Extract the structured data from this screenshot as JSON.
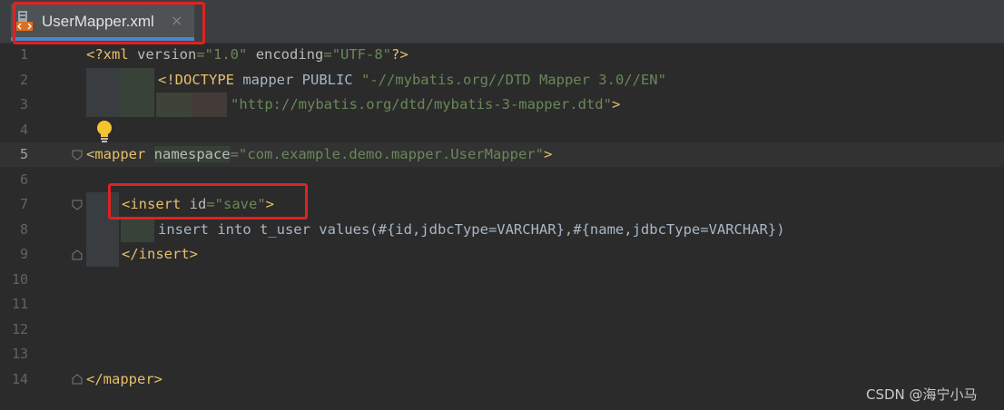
{
  "tab": {
    "title": "UserMapper.xml",
    "close_glyph": "×",
    "icon": "xml-file-icon"
  },
  "editor": {
    "current_line": 5,
    "line_numbers": [
      "1",
      "2",
      "3",
      "4",
      "5",
      "6",
      "7",
      "8",
      "9",
      "10",
      "11",
      "12",
      "13",
      "14"
    ],
    "lines": {
      "l1": {
        "a": "<?xml ",
        "b": "version",
        "c": "=",
        "d": "\"1.0\"",
        "e": " ",
        "f": "encoding",
        "g": "=",
        "h": "\"UTF-8\"",
        "i": "?>"
      },
      "l2": {
        "a": "<!DOCTYPE ",
        "b": "mapper PUBLIC ",
        "c": "\"-//mybatis.org//DTD Mapper 3.0//EN\""
      },
      "l3": {
        "a": "\"http://mybatis.org/dtd/mybatis-3-mapper.dtd\"",
        "b": ">"
      },
      "l5": {
        "a": "<mapper ",
        "b": "namespace",
        "c": "=",
        "d": "\"com.example.demo.mapper.UserMapper\"",
        "e": ">"
      },
      "l7": {
        "a": "<insert ",
        "b": "id",
        "c": "=",
        "d": "\"save\"",
        "e": ">"
      },
      "l8": {
        "a": "insert into t_user values(#{id,jdbcType=VARCHAR},#{name,jdbcType=VARCHAR})"
      },
      "l9": {
        "a": "</insert>"
      },
      "l14": {
        "a": "</mapper>"
      }
    }
  },
  "watermark": "CSDN @海宁小马",
  "colors": {
    "background": "#2b2b2b",
    "tag": "#e8bf6a",
    "attribute": "#bababa",
    "string": "#6a8759",
    "text": "#a9b7c6",
    "highlight_box": "#e02121",
    "tab_underline": "#4a88c7"
  },
  "icons": [
    "xml-file-icon",
    "close-icon",
    "lightbulb-icon",
    "fold-icon"
  ]
}
